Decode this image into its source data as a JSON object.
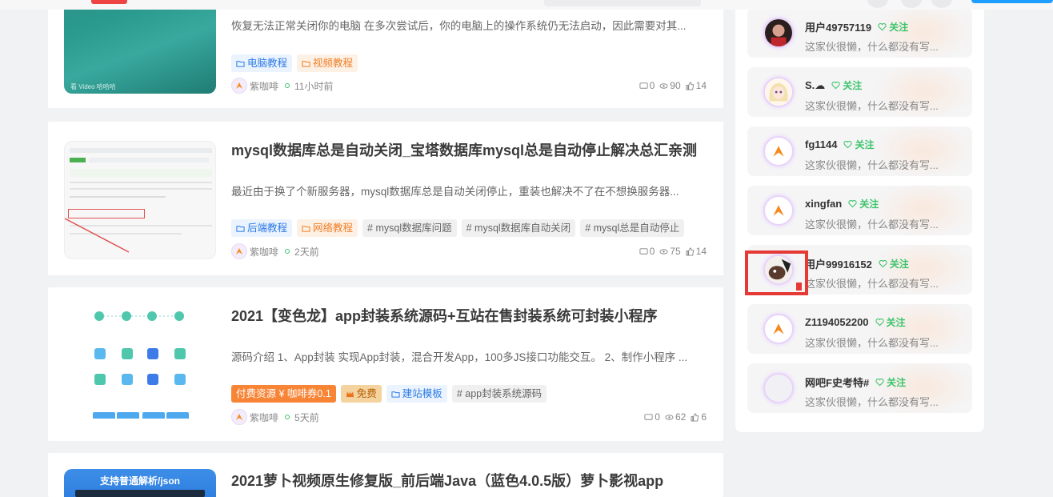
{
  "posts": [
    {
      "excerpt": "恢复无法正常关闭你的电脑 在多次尝试后，你的电脑上的操作系统仍无法启动，因此需要对其...",
      "tags": [
        {
          "label": "电脑教程",
          "style": "blue",
          "icon": "folder-icon"
        },
        {
          "label": "视频教程",
          "style": "orange",
          "icon": "folder-icon"
        }
      ],
      "author": "紫咖啡",
      "time": "11小时前",
      "comments": "0",
      "views": "90",
      "likes": "14",
      "thumb_caption": "看 Video 哈哈哈"
    },
    {
      "title": "mysql数据库总是自动关闭_宝塔数据库mysql总是自动停止解决总汇亲测",
      "excerpt": "最近由于换了个新服务器，mysql数据库总是自动关闭停止，重装也解决不了在不想换服务器...",
      "tags": [
        {
          "label": "后端教程",
          "style": "blue",
          "icon": "folder-icon"
        },
        {
          "label": "网络教程",
          "style": "orange",
          "icon": "folder-icon"
        },
        {
          "label": "# mysql数据库问题",
          "style": "gray",
          "icon": ""
        },
        {
          "label": "# mysql数据库自动关闭",
          "style": "gray",
          "icon": ""
        },
        {
          "label": "# mysql总是自动停止",
          "style": "gray",
          "icon": ""
        }
      ],
      "author": "紫咖啡",
      "time": "2天前",
      "comments": "0",
      "views": "75",
      "likes": "14"
    },
    {
      "title": "2021【变色龙】app封装系统源码+互站在售封装系统可封装小程序",
      "excerpt": "源码介绍 1、App封装 实现App封装，混合开发App，100多JS接口功能交互。 2、制作小程序 ...",
      "tags": [
        {
          "label": "付费资源 ¥ 咖啡券0.1",
          "style": "paid",
          "icon": ""
        },
        {
          "label": "免费",
          "style": "free",
          "icon": "crown-icon"
        },
        {
          "label": "建站模板",
          "style": "blue",
          "icon": "folder-icon"
        },
        {
          "label": "# app封装系统源码",
          "style": "gray",
          "icon": ""
        }
      ],
      "author": "紫咖啡",
      "time": "5天前",
      "comments": "0",
      "views": "62",
      "likes": "6"
    },
    {
      "title": "2021萝卜视频原生修复版_前后端Java（蓝色4.0.5版）萝卜影视app",
      "thumb_caption": "支持普通解析/json"
    }
  ],
  "users": [
    {
      "name": "用户49757119",
      "follow": "关注",
      "bio": "这家伙很懒，什么都没有写...",
      "avatar": "photo-avatar-icon"
    },
    {
      "name": "S.☁",
      "follow": "关注",
      "bio": "这家伙很懒，什么都没有写...",
      "avatar": "anime-avatar-icon"
    },
    {
      "name": "fg1144",
      "follow": "关注",
      "bio": "这家伙很懒，什么都没有写...",
      "avatar": "default-avatar-icon"
    },
    {
      "name": "xingfan",
      "follow": "关注",
      "bio": "这家伙很懒，什么都没有写...",
      "avatar": "default-avatar-icon"
    },
    {
      "name": "用户99916152",
      "follow": "关注",
      "bio": "这家伙很懒，什么都没有写...",
      "avatar": "photo-avatar-icon"
    },
    {
      "name": "Z1194052200",
      "follow": "关注",
      "bio": "这家伙很懒，什么都没有写...",
      "avatar": "default-avatar-icon"
    },
    {
      "name": "网吧F史考特#",
      "follow": "关注",
      "bio": "这家伙很懒，什么都没有写...",
      "avatar": "empty-avatar-icon"
    }
  ],
  "colors": {
    "accent_green": "#3cc46b",
    "tag_blue": "#2f7ce6",
    "tag_orange": "#f07f26",
    "paid_orange": "#f88435",
    "highlight_red": "#e53935"
  }
}
